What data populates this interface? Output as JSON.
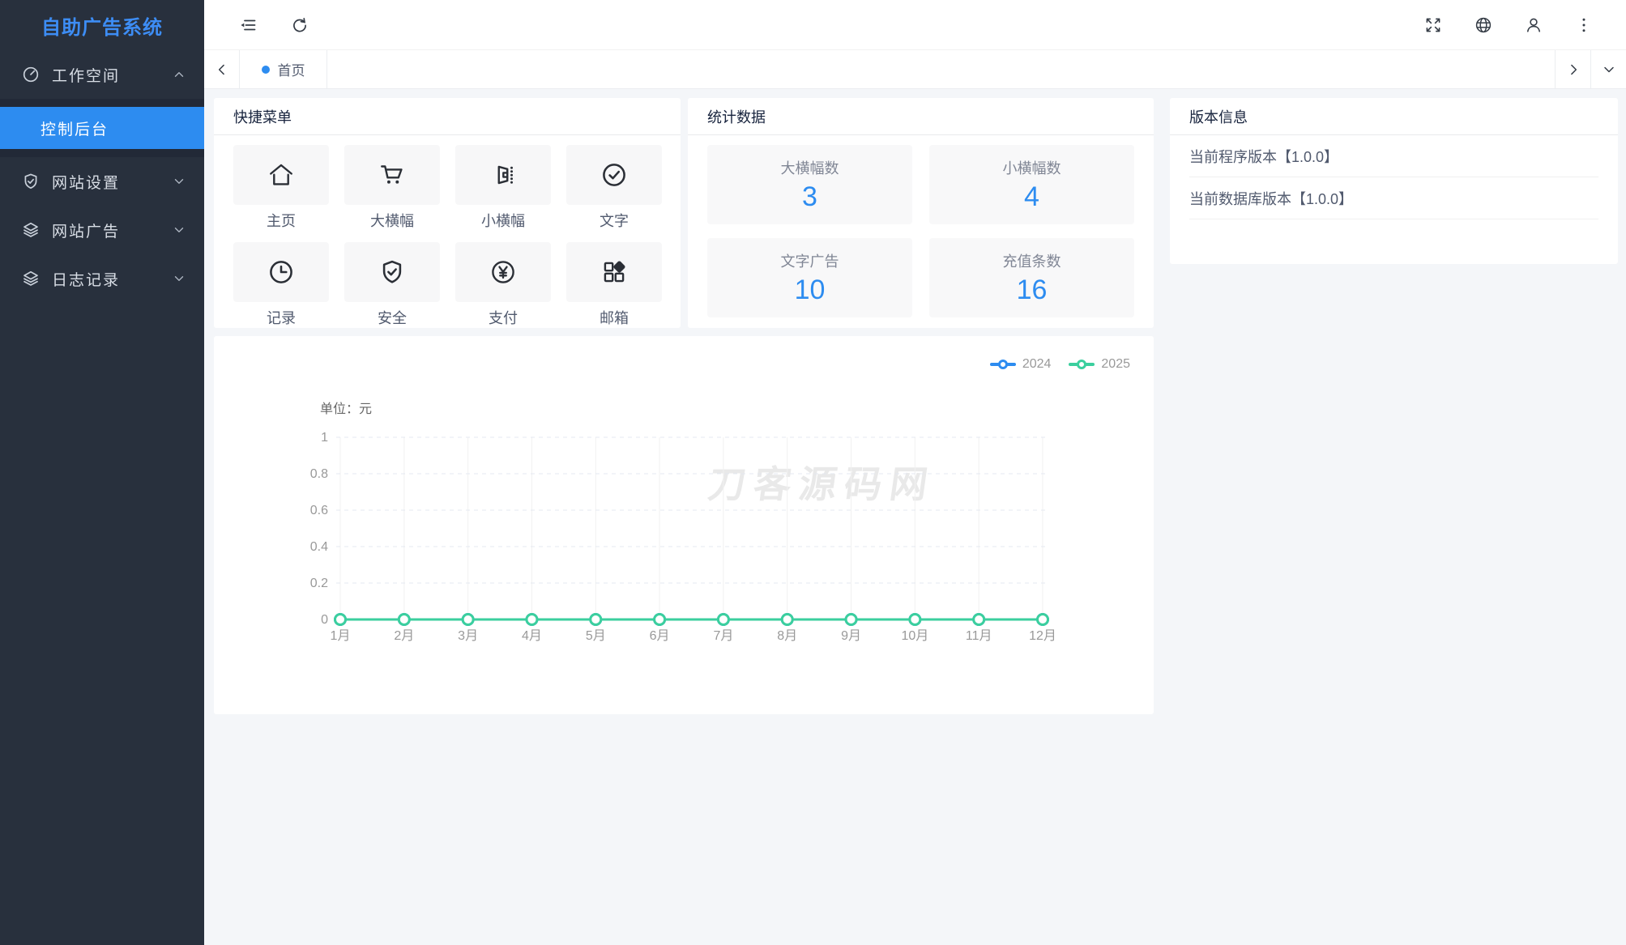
{
  "app": {
    "logo_title": "自助广告系统"
  },
  "sidebar": {
    "items": [
      {
        "label": "工作空间",
        "icon": "dashboard-icon",
        "expanded": true,
        "children": [
          {
            "label": "控制后台",
            "active": true
          }
        ]
      },
      {
        "label": "网站设置",
        "icon": "shield-check-icon",
        "expanded": false
      },
      {
        "label": "网站广告",
        "icon": "layers-icon",
        "expanded": false
      },
      {
        "label": "日志记录",
        "icon": "layers-icon",
        "expanded": false
      }
    ]
  },
  "header": {
    "left_icons": [
      "menu-fold-icon",
      "refresh-icon"
    ],
    "right_icons": [
      "fullscreen-icon",
      "globe-icon",
      "user-icon",
      "more-vertical-icon"
    ]
  },
  "tabbar": {
    "tabs": [
      {
        "label": "首页",
        "active": true
      }
    ]
  },
  "quick_menu": {
    "title": "快捷菜单",
    "items": [
      {
        "label": "主页",
        "icon": "home-icon"
      },
      {
        "label": "大横幅",
        "icon": "cart-icon"
      },
      {
        "label": "小横幅",
        "icon": "banner-exit-icon"
      },
      {
        "label": "文字",
        "icon": "check-circle-icon"
      },
      {
        "label": "记录",
        "icon": "clock-icon"
      },
      {
        "label": "安全",
        "icon": "shield-check-icon"
      },
      {
        "label": "支付",
        "icon": "yen-circle-icon"
      },
      {
        "label": "邮箱",
        "icon": "grid-app-icon"
      }
    ]
  },
  "stats": {
    "title": "统计数据",
    "items": [
      {
        "label": "大横幅数",
        "value": "3"
      },
      {
        "label": "小横幅数",
        "value": "4"
      },
      {
        "label": "文字广告",
        "value": "10"
      },
      {
        "label": "充值条数",
        "value": "16"
      }
    ]
  },
  "version": {
    "title": "版本信息",
    "items": [
      {
        "text": "当前程序版本【1.0.0】"
      },
      {
        "text": "当前数据库版本【1.0.0】"
      }
    ]
  },
  "chart_data": {
    "type": "line",
    "title": "",
    "unit_label": "单位：元",
    "categories": [
      "1月",
      "2月",
      "3月",
      "4月",
      "5月",
      "6月",
      "7月",
      "8月",
      "9月",
      "10月",
      "11月",
      "12月"
    ],
    "series": [
      {
        "name": "2024",
        "color": "#2d8cf0",
        "values": [
          0,
          0,
          0,
          0,
          0,
          0,
          0,
          0,
          0,
          0,
          0,
          0
        ]
      },
      {
        "name": "2025",
        "color": "#3bcf9e",
        "values": [
          0,
          0,
          0,
          0,
          0,
          0,
          0,
          0,
          0,
          0,
          0,
          0
        ]
      }
    ],
    "ylim": [
      0,
      1
    ],
    "yticks": [
      0,
      0.2,
      0.4,
      0.6,
      0.8,
      1
    ],
    "grid": true,
    "legend_position": "top-right",
    "watermark": "刀客源码网"
  },
  "colors": {
    "accent_blue": "#2d8cf0",
    "accent_green": "#3bcf9e",
    "sidebar_bg": "#28303d",
    "submenu_bg": "#222937",
    "content_bg": "#f4f6f9"
  }
}
